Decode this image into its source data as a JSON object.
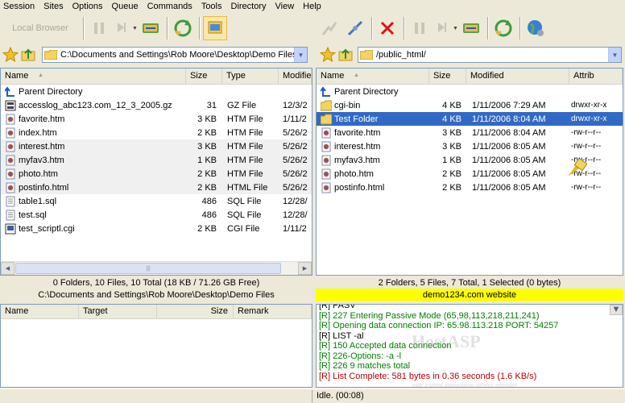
{
  "menu": [
    "Session",
    "Sites",
    "Options",
    "Queue",
    "Commands",
    "Tools",
    "Directory",
    "View",
    "Help"
  ],
  "toolbar_left": {
    "local_browser_label": "Local Browser"
  },
  "left": {
    "path": "C:\\Documents and Settings\\Rob Moore\\Desktop\\Demo Files",
    "columns": [
      "Name",
      "Size",
      "Type",
      "Modifie"
    ],
    "rows": [
      {
        "name": "Parent Directory",
        "size": "",
        "type": "",
        "modified": "",
        "icon": "parent-dir-icon"
      },
      {
        "name": "accesslog_abc123.com_12_3_2005.gz",
        "size": "31",
        "type": "GZ File",
        "modified": "12/3/2",
        "icon": "gz-file-icon"
      },
      {
        "name": "favorite.htm",
        "size": "3 KB",
        "type": "HTM File",
        "modified": "1/11/2",
        "icon": "htm-file-icon"
      },
      {
        "name": "index.htm",
        "size": "2 KB",
        "type": "HTM File",
        "modified": "5/26/2",
        "icon": "htm-file-icon"
      },
      {
        "name": "interest.htm",
        "size": "3 KB",
        "type": "HTM File",
        "modified": "5/26/2",
        "icon": "htm-file-icon"
      },
      {
        "name": "myfav3.htm",
        "size": "1 KB",
        "type": "HTM File",
        "modified": "5/26/2",
        "icon": "htm-file-icon"
      },
      {
        "name": "photo.htm",
        "size": "2 KB",
        "type": "HTM File",
        "modified": "5/26/2",
        "icon": "htm-file-icon"
      },
      {
        "name": "postinfo.html",
        "size": "2 KB",
        "type": "HTML File",
        "modified": "5/26/2",
        "icon": "htm-file-icon"
      },
      {
        "name": "table1.sql",
        "size": "486",
        "type": "SQL File",
        "modified": "12/28/",
        "icon": "text-file-icon"
      },
      {
        "name": "test.sql",
        "size": "486",
        "type": "SQL File",
        "modified": "12/28/",
        "icon": "text-file-icon"
      },
      {
        "name": "test_scriptl.cgi",
        "size": "2 KB",
        "type": "CGI File",
        "modified": "1/11/2",
        "icon": "cgi-file-icon"
      }
    ],
    "status": "0 Folders, 10 Files, 10 Total (18 KB / 71.26 GB Free)",
    "path_status": "C:\\Documents and Settings\\Rob Moore\\Desktop\\Demo Files"
  },
  "right": {
    "path": "/public_html/",
    "columns": [
      "Name",
      "Size",
      "Modified",
      "Attrib"
    ],
    "rows": [
      {
        "name": "Parent Directory",
        "size": "",
        "modified": "",
        "attrib": "",
        "icon": "parent-dir-icon"
      },
      {
        "name": "cgi-bin",
        "size": "4 KB",
        "modified": "1/11/2006 7:29 AM",
        "attrib": "drwxr-xr-x",
        "icon": "folder-icon"
      },
      {
        "name": "Test Folder",
        "size": "4 KB",
        "modified": "1/11/2006 8:04 AM",
        "attrib": "drwxr-xr-x",
        "icon": "folder-icon",
        "selected": true
      },
      {
        "name": "favorite.htm",
        "size": "3 KB",
        "modified": "1/11/2006 8:04 AM",
        "attrib": "-rw-r--r--",
        "icon": "htm-file-icon"
      },
      {
        "name": "interest.htm",
        "size": "3 KB",
        "modified": "1/11/2006 8:05 AM",
        "attrib": "-rw-r--r--",
        "icon": "htm-file-icon"
      },
      {
        "name": "myfav3.htm",
        "size": "1 KB",
        "modified": "1/11/2006 8:05 AM",
        "attrib": "-rw-r--r--",
        "icon": "htm-file-icon"
      },
      {
        "name": "photo.htm",
        "size": "2 KB",
        "modified": "1/11/2006 8:05 AM",
        "attrib": "-rw-r--r--",
        "icon": "htm-file-icon"
      },
      {
        "name": "postinfo.html",
        "size": "2 KB",
        "modified": "1/11/2006 8:05 AM",
        "attrib": "-rw-r--r--",
        "icon": "htm-file-icon"
      }
    ],
    "status": "2 Folders, 5 Files, 7 Total, 1 Selected (0 bytes)",
    "site_status": "demo1234.com website"
  },
  "queue": {
    "columns": [
      "Name",
      "Target",
      "Size",
      "Remark"
    ]
  },
  "log": [
    {
      "text": "[R] PASV",
      "color": "#000000"
    },
    {
      "text": "[R] 227 Entering Passive Mode (65,98,113,218,211,241)",
      "color": "#008000"
    },
    {
      "text": "[R] Opening data connection IP: 65.98.113.218 PORT: 54257",
      "color": "#008000"
    },
    {
      "text": "[R] LIST -al",
      "color": "#000000"
    },
    {
      "text": "[R] 150 Accepted data connection",
      "color": "#008000"
    },
    {
      "text": "[R] 226-Options: -a -l",
      "color": "#008000"
    },
    {
      "text": "[R] 226 9 matches total",
      "color": "#008000"
    },
    {
      "text": "[R] List Complete: 581 bytes in 0.36 seconds (1.6 KB/s)",
      "color": "#c00000"
    }
  ],
  "watermark": {
    "brand": "HostASP",
    "tagline": "your trusted application service provider"
  },
  "statusbar": {
    "text": "Idle. (00:08)"
  },
  "colors": {
    "selection": "#316ac5",
    "site_status_bg": "#ffff00",
    "log_green": "#008000",
    "log_red": "#c00000"
  }
}
